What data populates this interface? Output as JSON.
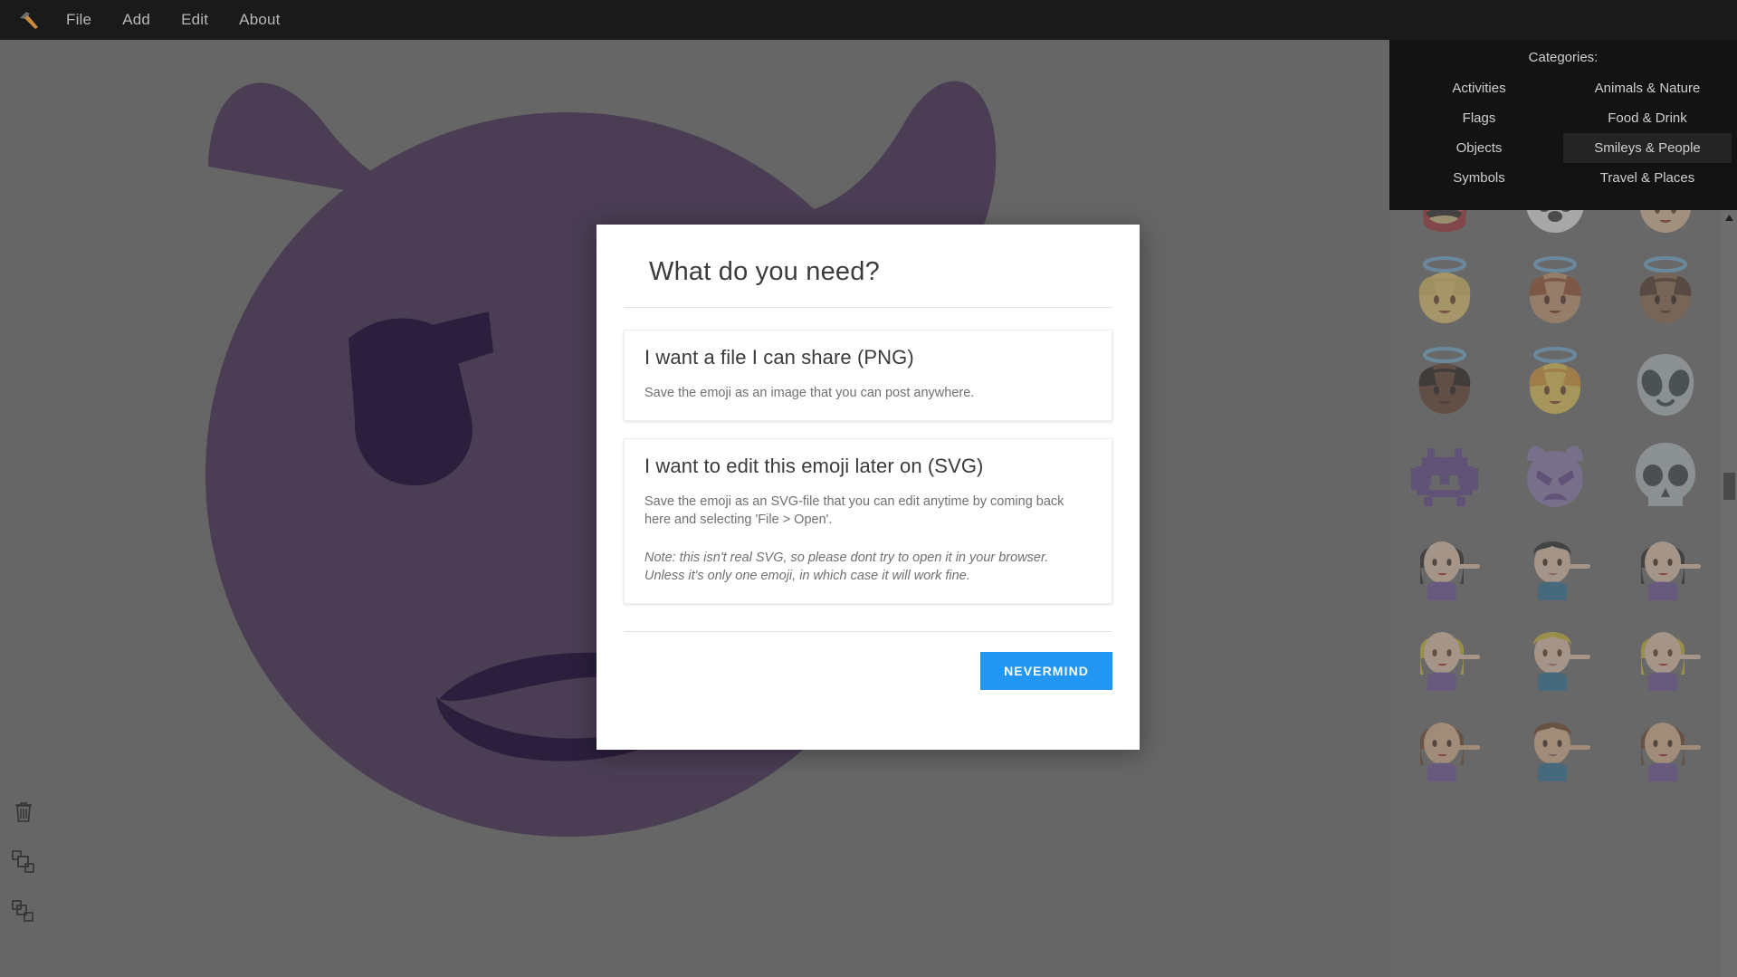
{
  "menubar": {
    "logo_icon": "hammer-icon",
    "items": [
      {
        "label": "File"
      },
      {
        "label": "Add"
      },
      {
        "label": "Edit"
      },
      {
        "label": "About"
      }
    ]
  },
  "toolbar": {
    "buttons": [
      {
        "icon": "trash-icon",
        "name": "delete-button"
      },
      {
        "icon": "bring-forward-icon",
        "name": "bring-forward-button"
      },
      {
        "icon": "send-backward-icon",
        "name": "send-backward-button"
      }
    ]
  },
  "canvas": {
    "emoji_name": "imp-devil-face",
    "background_color": "#666666",
    "face_color": "#4a3d54",
    "detail_color": "#2a1f3d"
  },
  "side_panel": {
    "categories_label": "Categories:",
    "categories": [
      {
        "label": "Activities",
        "active": false
      },
      {
        "label": "Animals & Nature",
        "active": false
      },
      {
        "label": "Flags",
        "active": false
      },
      {
        "label": "Food & Drink",
        "active": false
      },
      {
        "label": "Objects",
        "active": false
      },
      {
        "label": "Smileys & People",
        "active": true
      },
      {
        "label": "Symbols",
        "active": false
      },
      {
        "label": "Travel & Places",
        "active": false
      }
    ],
    "scrollbar": {
      "up_arrow_icon": "chevron-up-icon"
    },
    "emojis": [
      {
        "name": "japanese-ogre"
      },
      {
        "name": "panda-face"
      },
      {
        "name": "angel-dark-hair"
      },
      {
        "name": "angel-blonde-light"
      },
      {
        "name": "angel-auburn-medium"
      },
      {
        "name": "angel-dark-skin"
      },
      {
        "name": "angel-black-hair-dark"
      },
      {
        "name": "angel-blonde-medium"
      },
      {
        "name": "alien"
      },
      {
        "name": "space-invader"
      },
      {
        "name": "angry-imp"
      },
      {
        "name": "skull"
      },
      {
        "name": "person-tipping-hand-woman-light"
      },
      {
        "name": "person-tipping-hand-man-light"
      },
      {
        "name": "person-tipping-hand-woman-light-2"
      },
      {
        "name": "person-tipping-hand-blonde-woman"
      },
      {
        "name": "person-tipping-hand-blonde-man"
      },
      {
        "name": "person-tipping-hand-blonde-woman-2"
      },
      {
        "name": "person-tipping-hand-brown-woman"
      },
      {
        "name": "person-tipping-hand-brown-man"
      },
      {
        "name": "person-tipping-hand-brown-woman-2"
      }
    ]
  },
  "modal": {
    "title": "What do you need?",
    "options": [
      {
        "title": "I want a file I can share (PNG)",
        "description": "Save the emoji as an image that you can post anywhere.",
        "note": ""
      },
      {
        "title": "I want to edit this emoji later on (SVG)",
        "description": "Save the emoji as an SVG-file that you can edit anytime by coming back here and selecting 'File > Open'.",
        "note": "Note: this isn't real SVG, so please dont try to open it in your browser. Unless it's only one emoji, in which case it will work fine."
      }
    ],
    "cancel_label": "NEVERMIND",
    "accent_color": "#2196f3"
  }
}
